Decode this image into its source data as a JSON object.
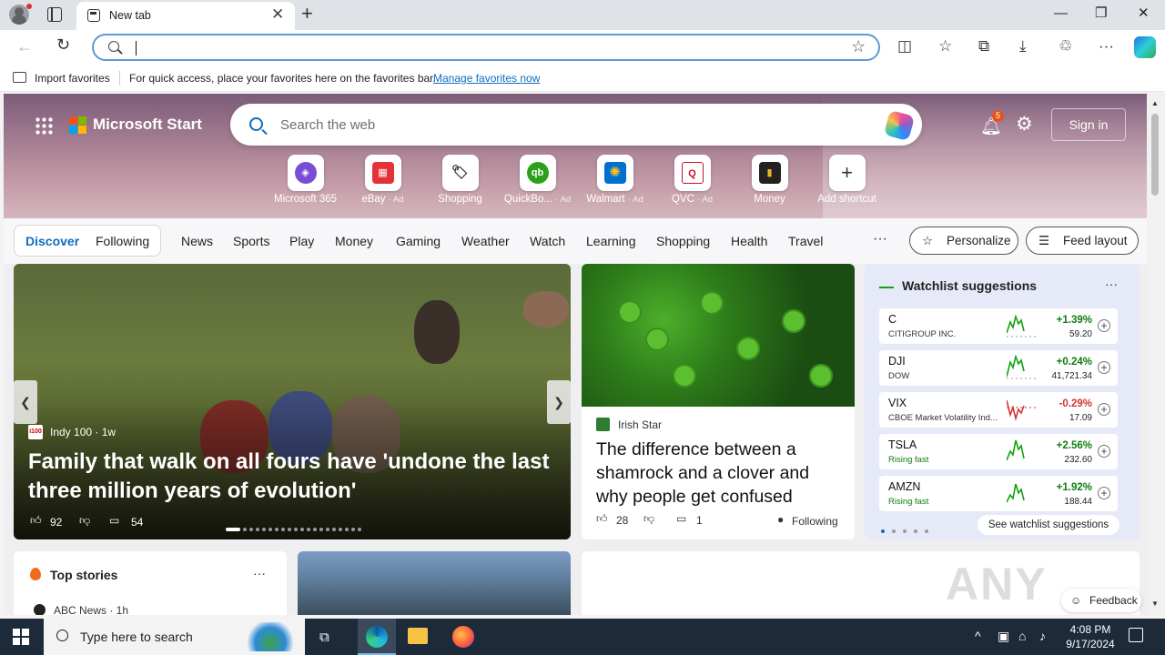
{
  "browser": {
    "tab_title": "New tab",
    "tab_close": "✕",
    "new_tab": "+",
    "window_controls": [
      "—",
      "❐",
      "✕"
    ]
  },
  "toolbar": {
    "back": "←",
    "refresh": "↻",
    "address_value": "",
    "star": "☆",
    "icons": [
      "split-screen-icon",
      "favorites-icon",
      "collections-icon",
      "downloads-icon",
      "extensions-icon",
      "more-icon"
    ]
  },
  "favbar": {
    "import": "Import favorites",
    "hint": "For quick access, place your favorites here on the favorites bar.",
    "manage_link": "Manage favorites now"
  },
  "header": {
    "brand": "Microsoft Start",
    "search_placeholder": "Search the web",
    "notifications_count": "5",
    "sign_in": "Sign in"
  },
  "shortcuts": [
    {
      "label": "Microsoft 365",
      "ad": "",
      "color": "#7b4dd6",
      "glyph": "◈"
    },
    {
      "label": "eBay",
      "ad": "· Ad",
      "color": "#e53238",
      "glyph": "▦"
    },
    {
      "label": "Shopping",
      "ad": "",
      "color": "#ffffff",
      "glyph": "🏷"
    },
    {
      "label": "QuickBo...",
      "ad": "· Ad",
      "color": "#2ca01c",
      "glyph": "qb"
    },
    {
      "label": "Walmart",
      "ad": "· Ad",
      "color": "#0071ce",
      "glyph": "✺"
    },
    {
      "label": "QVC",
      "ad": "· Ad",
      "color": "#ffffff",
      "glyph": "Q"
    },
    {
      "label": "Money",
      "ad": "",
      "color": "#222222",
      "glyph": "▮"
    },
    {
      "label": "Add shortcut",
      "ad": "",
      "color": "#ffffff",
      "glyph": "+"
    }
  ],
  "nav": {
    "discover": "Discover",
    "following": "Following",
    "links": [
      "News",
      "Sports",
      "Play",
      "Money",
      "Gaming",
      "Weather",
      "Watch",
      "Learning",
      "Shopping",
      "Health",
      "Travel"
    ],
    "more": "···",
    "personalize": "Personalize",
    "feed_layout": "Feed layout"
  },
  "hero_article": {
    "source": "Indy 100 · 1w",
    "source_icon": "i100",
    "title": "Family that walk on all fours have 'undone the last three million years of evolution'",
    "likes": "92",
    "comments": "54",
    "prev": "❮",
    "next": "❯"
  },
  "shamrock_article": {
    "source": "Irish Star",
    "title": "The difference between a shamrock and a clover and why people get confused",
    "likes": "28",
    "comments": "1",
    "following": "Following"
  },
  "watchlist": {
    "title": "Watchlist suggestions",
    "more": "···",
    "link": "See watchlist suggestions",
    "stocks": [
      {
        "symbol": "C",
        "name": "CITIGROUP INC.",
        "change": "+1.39%",
        "price": "59.20",
        "up": true
      },
      {
        "symbol": "DJI",
        "name": "DOW",
        "change": "+0.24%",
        "price": "41,721.34",
        "up": true
      },
      {
        "symbol": "VIX",
        "name": "CBOE Market Volatility Ind...",
        "change": "-0.29%",
        "price": "17.09",
        "up": false
      },
      {
        "symbol": "TSLA",
        "name": "Rising fast",
        "change": "+2.56%",
        "price": "232.60",
        "up": true
      },
      {
        "symbol": "AMZN",
        "name": "Rising fast",
        "change": "+1.92%",
        "price": "188.44",
        "up": true
      }
    ]
  },
  "top_stories": {
    "title": "Top stories",
    "more": "···",
    "source": "ABC News · 1h"
  },
  "feedback": "Feedback",
  "taskbar": {
    "search_placeholder": "Type here to search",
    "time": "4:08 PM",
    "date": "9/17/2024"
  }
}
